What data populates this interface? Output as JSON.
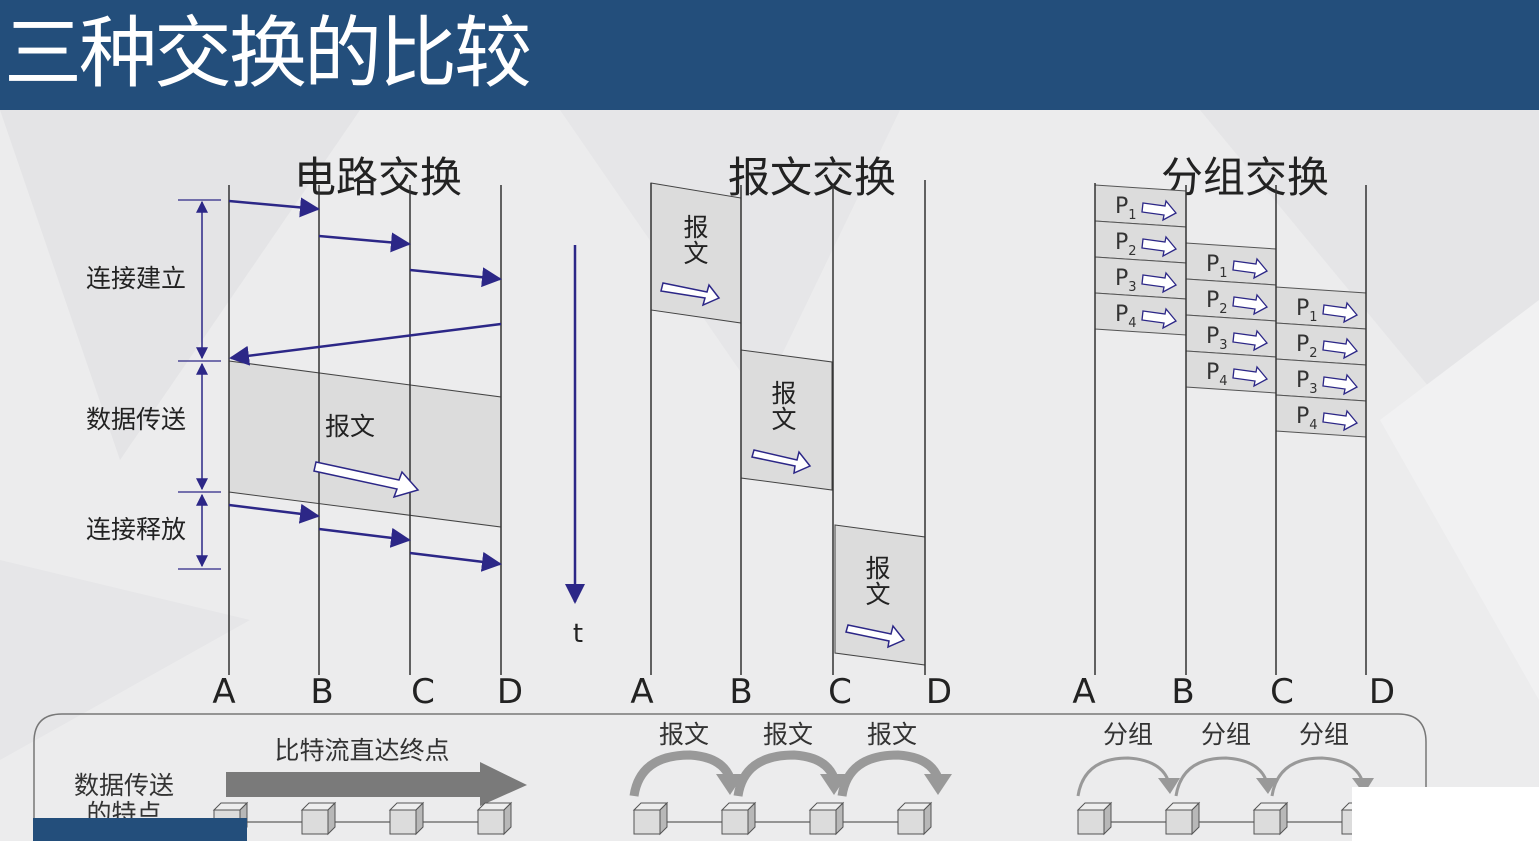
{
  "title": "三种交换的比较",
  "circuit": {
    "heading": "电路交换",
    "phases": [
      "连接建立",
      "数据传送",
      "连接释放"
    ],
    "message_label": "报文",
    "nodes": [
      "A",
      "B",
      "C",
      "D"
    ]
  },
  "time_axis_label": "t",
  "message": {
    "heading": "报文交换",
    "block_label_top": "报",
    "block_label_bottom": "文",
    "nodes": [
      "A",
      "B",
      "C",
      "D"
    ]
  },
  "packet": {
    "heading": "分组交换",
    "packets": [
      "P",
      "P",
      "P",
      "P"
    ],
    "packet_subscripts": [
      "1",
      "2",
      "3",
      "4"
    ],
    "nodes": [
      "A",
      "B",
      "C",
      "D"
    ]
  },
  "bottom_panel": {
    "row_label_line1": "数据传送",
    "row_label_line2": "的特点",
    "circuit_caption": "比特流直达终点",
    "message_captions": [
      "报文",
      "报文",
      "报文"
    ],
    "packet_captions": [
      "分组",
      "分组",
      "分组"
    ]
  },
  "colors": {
    "header": "#234e7b",
    "arrow": "#2c2787",
    "box": "#dcdcdc",
    "line": "#333333"
  }
}
